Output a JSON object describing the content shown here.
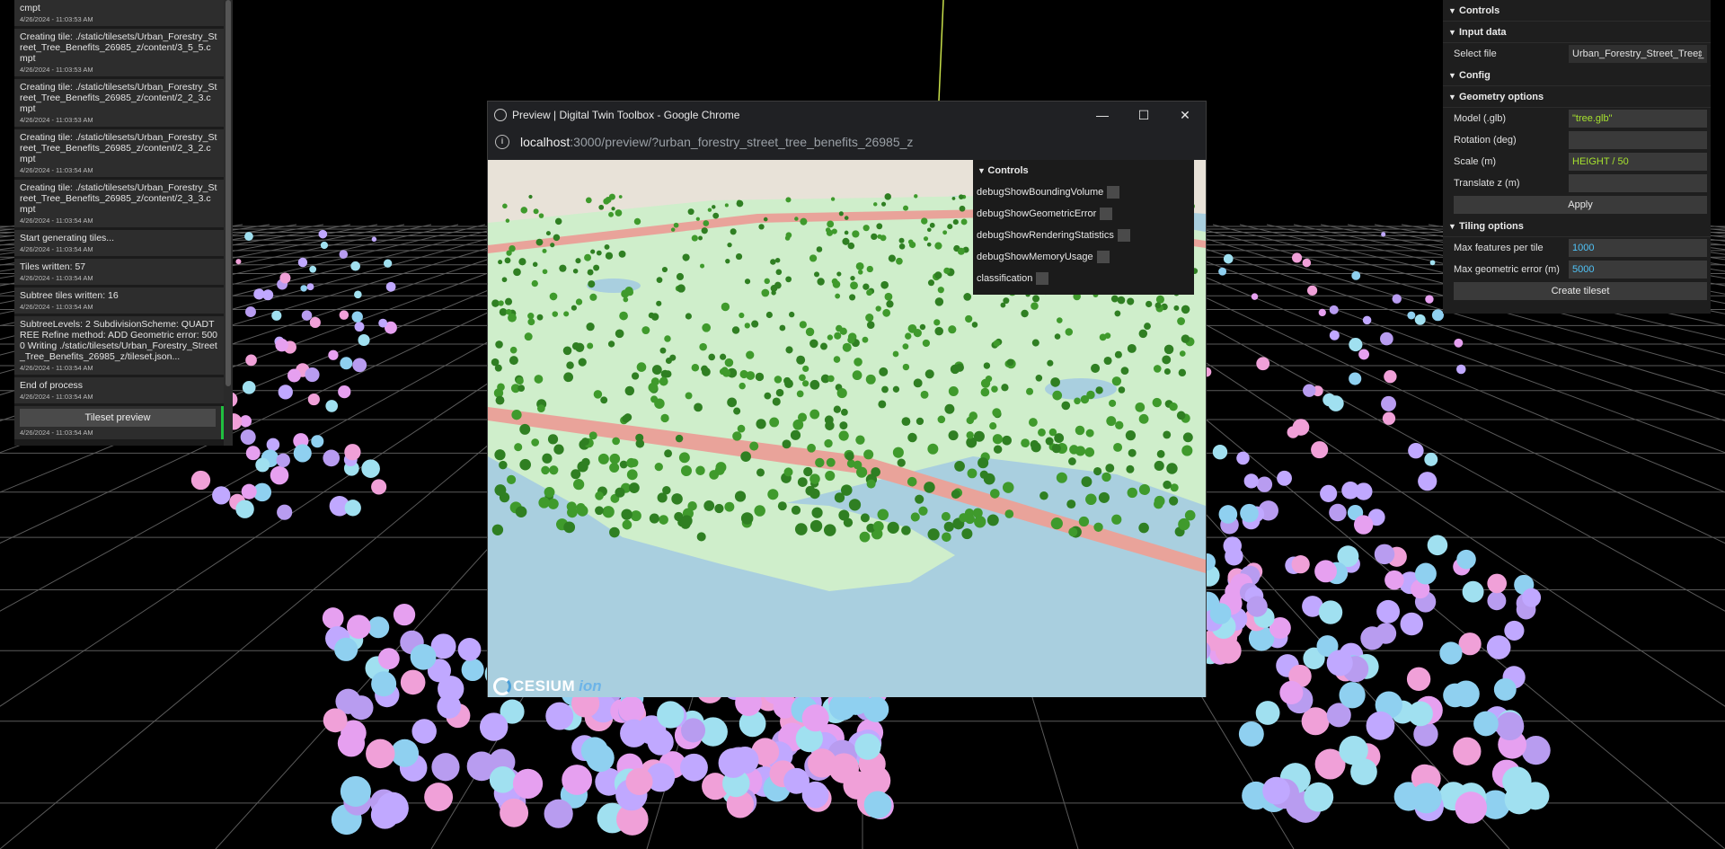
{
  "log": {
    "entries": [
      {
        "message": "cmpt",
        "time": "4/26/2024 - 11:03:53 AM"
      },
      {
        "message": "Creating tile: ./static/tilesets/Urban_Forestry_Street_Tree_Benefits_26985_z/content/3_5_5.cmpt",
        "time": "4/26/2024 - 11:03:53 AM"
      },
      {
        "message": "Creating tile: ./static/tilesets/Urban_Forestry_Street_Tree_Benefits_26985_z/content/2_2_3.cmpt",
        "time": "4/26/2024 - 11:03:53 AM"
      },
      {
        "message": "Creating tile: ./static/tilesets/Urban_Forestry_Street_Tree_Benefits_26985_z/content/2_3_2.cmpt",
        "time": "4/26/2024 - 11:03:54 AM"
      },
      {
        "message": "Creating tile: ./static/tilesets/Urban_Forestry_Street_Tree_Benefits_26985_z/content/2_3_3.cmpt",
        "time": "4/26/2024 - 11:03:54 AM"
      },
      {
        "message": "Start generating tiles...",
        "time": "4/26/2024 - 11:03:54 AM"
      },
      {
        "message": "Tiles written: 57",
        "time": "4/26/2024 - 11:03:54 AM"
      },
      {
        "message": "Subtree tiles written: 16",
        "time": "4/26/2024 - 11:03:54 AM"
      },
      {
        "message": "SubtreeLevels: 2 SubdivisionScheme: QUADTREE Refine method: ADD Geometric error: 5000 Writing ./static/tilesets/Urban_Forestry_Street_Tree_Benefits_26985_z/tileset.json...",
        "time": "4/26/2024 - 11:03:54 AM"
      },
      {
        "message": "End of process",
        "time": "4/26/2024 - 11:03:54 AM"
      }
    ],
    "preview_button": "Tileset preview",
    "preview_time": "4/26/2024 - 11:03:54 AM"
  },
  "controls": {
    "title": "Controls",
    "input_data": {
      "title": "Input data",
      "select_file_label": "Select file",
      "select_file_value": "Urban_Forestry_Street_Tree_"
    },
    "config": {
      "title": "Config"
    },
    "geometry": {
      "title": "Geometry options",
      "model_label": "Model (.glb)",
      "model_value": "\"tree.glb\"",
      "rotation_label": "Rotation (deg)",
      "rotation_value": "",
      "scale_label": "Scale (m)",
      "scale_value": "HEIGHT / 50",
      "translate_label": "Translate z (m)",
      "translate_value": "",
      "apply_button": "Apply"
    },
    "tiling": {
      "title": "Tiling options",
      "max_features_label": "Max features per tile",
      "max_features_value": "1000",
      "max_geom_error_label": "Max geometric error (m)",
      "max_geom_error_value": "5000",
      "create_button": "Create tileset"
    }
  },
  "browser": {
    "title": "Preview | Digital Twin Toolbox - Google Chrome",
    "url_host": "localhost",
    "url_rest": ":3000/preview/?urban_forestry_street_tree_benefits_26985_z",
    "preview_controls": {
      "title": "Controls",
      "options": [
        "debugShowBoundingVolume",
        "debugShowGeometricError",
        "debugShowRenderingStatistics",
        "debugShowMemoryUsage",
        "classification"
      ]
    },
    "logo_text": "CESIUM",
    "logo_suffix": "ion"
  },
  "colors": {
    "accent_green": "#20c040",
    "value_green": "#a6e22e",
    "value_blue": "#4fc3f7",
    "tree_green": "#3f9a2c",
    "water": "#a9cfdf",
    "park": "#cfeecb",
    "road": "#e9a39a"
  },
  "icons": {
    "chevron": "chevron-down-icon",
    "globe": "globe-icon",
    "info": "info-icon",
    "minimize": "minimize-icon",
    "maximize": "maximize-icon",
    "close": "close-icon"
  }
}
